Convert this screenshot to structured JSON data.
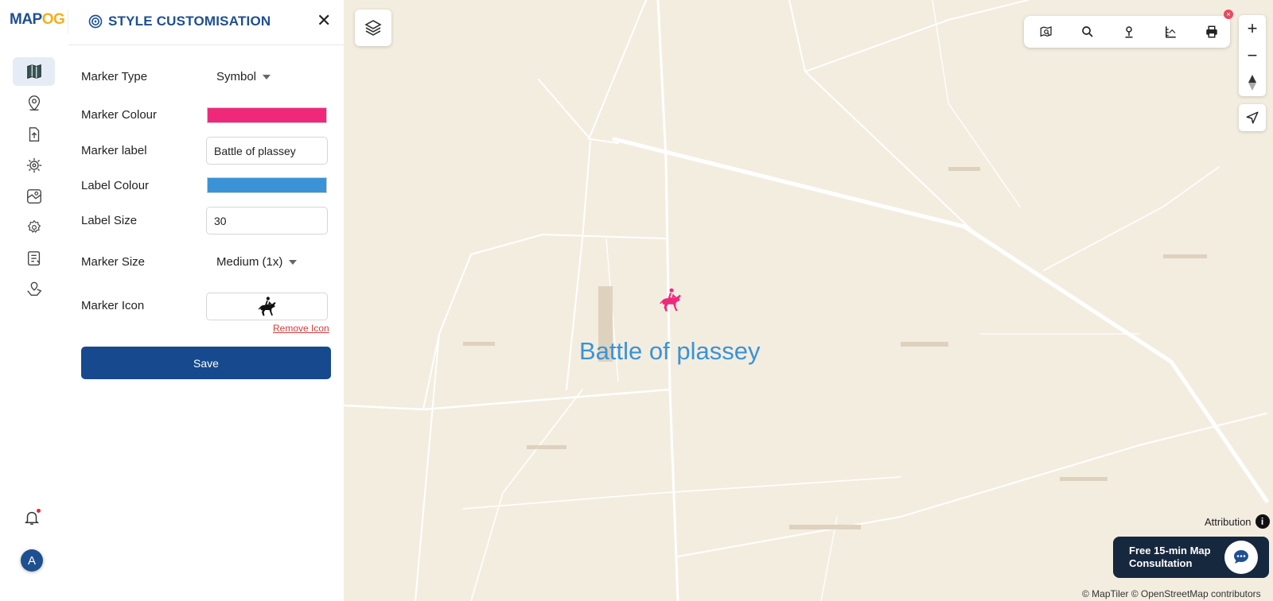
{
  "app": {
    "logo_map": "MAP",
    "logo_og": "OG"
  },
  "panel": {
    "title": "STYLE CUSTOMISATION",
    "close": "✕",
    "fields": {
      "marker_type_label": "Marker Type",
      "marker_type_value": "Symbol",
      "marker_colour_label": "Marker Colour",
      "marker_colour_value": "#f0287a",
      "marker_label_label": "Marker label",
      "marker_label_value": "Battle of plassey",
      "label_colour_label": "Label Colour",
      "label_colour_value": "#3a93d6",
      "label_size_label": "Label Size",
      "label_size_value": "30",
      "marker_size_label": "Marker Size",
      "marker_size_value": "Medium (1x)",
      "marker_icon_label": "Marker Icon",
      "marker_icon_name": "horse-rider-icon"
    },
    "remove_icon": "Remove Icon",
    "save": "Save"
  },
  "rail": {
    "items": [
      "map-icon",
      "location-pin-icon",
      "upload-file-icon",
      "gear-cog-icon",
      "map-edit-icon",
      "settings-eye-icon",
      "report-list-icon",
      "map-pin-hand-icon"
    ],
    "avatar": "A"
  },
  "map": {
    "marker_label": "Battle of plassey",
    "toolbar": [
      "map-search-icon",
      "search-icon",
      "pin-icon",
      "measure-icon",
      "print-icon"
    ],
    "toolbar_badge": "×",
    "zoom_in": "+",
    "zoom_out": "−",
    "attribution": "Attribution",
    "info": "i",
    "consultation": "Free 15-min Map Consultation",
    "credits": "© MapTiler © OpenStreetMap contributors"
  },
  "colors": {
    "brand": "#1e4f91",
    "marker": "#f0287a",
    "label": "#3a93d6",
    "map_bg": "#f3ede0"
  }
}
